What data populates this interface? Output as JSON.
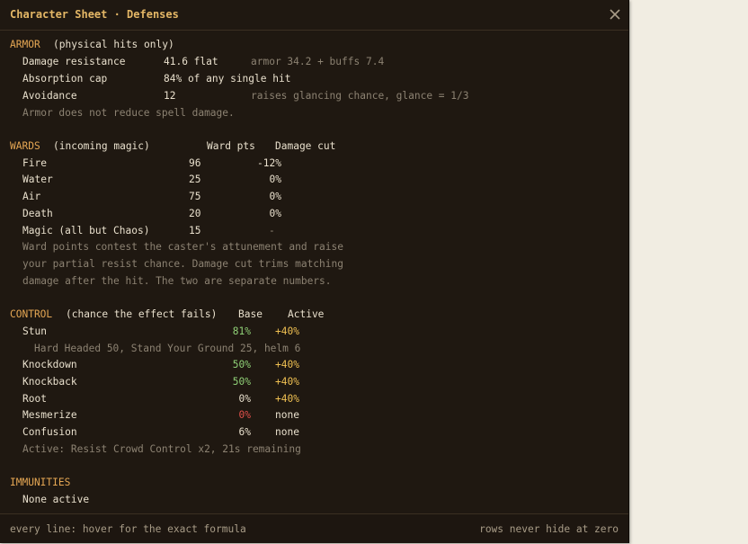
{
  "window": {
    "title": "Character Sheet · Defenses",
    "close_icon": "close-icon"
  },
  "armor": {
    "heading": "ARMOR",
    "subheading": "(physical hits only)",
    "rows": [
      {
        "label": "Damage resistance",
        "value": "41.6 flat",
        "note": "armor 34.2 + buffs 7.4"
      },
      {
        "label": "Absorption cap",
        "value": "84% of any single hit",
        "note": ""
      },
      {
        "label": "Avoidance",
        "value": "12",
        "note": "raises glancing chance, glance = 1/3"
      }
    ],
    "footnote": "Armor does not reduce spell damage."
  },
  "wards": {
    "heading": "WARDS",
    "subheading": "(incoming magic)",
    "col_pts": "Ward pts",
    "col_cut": "Damage cut",
    "rows": [
      {
        "label": "Fire",
        "pts": "96",
        "cut": "-12%"
      },
      {
        "label": "Water",
        "pts": "25",
        "cut": "0%"
      },
      {
        "label": "Air",
        "pts": "75",
        "cut": "0%"
      },
      {
        "label": "Death",
        "pts": "20",
        "cut": "0%"
      },
      {
        "label": "Magic (all but Chaos)",
        "pts": "15",
        "cut": "-"
      }
    ],
    "footnote": [
      "Ward points contest the caster's attunement and raise",
      "your partial resist chance. Damage cut trims matching",
      "damage after the hit. The two are separate numbers."
    ]
  },
  "control": {
    "heading": "CONTROL",
    "subheading": "(chance the effect fails)",
    "col_base": "Base",
    "col_active": "Active",
    "rows": [
      {
        "label": "Stun",
        "base": "81%",
        "active": "+40%",
        "base_color": "#8fcf76",
        "active_color": "#f0c152"
      },
      {
        "label": "Knockdown",
        "base": "50%",
        "active": "+40%",
        "base_color": "#8fcf76",
        "active_color": "#f0c152"
      },
      {
        "label": "Knockback",
        "base": "50%",
        "active": "+40%",
        "base_color": "#8fcf76",
        "active_color": "#f0c152"
      },
      {
        "label": "Root",
        "base": "0%",
        "active": "+40%",
        "base_color": "#e9e0cd",
        "active_color": "#f0c152"
      },
      {
        "label": "Mesmerize",
        "base": "0%",
        "active": "none",
        "base_color": "#e0504a",
        "active_color": "#e9e0cd"
      },
      {
        "label": "Confusion",
        "base": "6%",
        "active": "none",
        "base_color": "#e9e0cd",
        "active_color": "#e9e0cd"
      }
    ],
    "stun_detail": "Hard Headed 50, Stand Your Ground 25, helm 6",
    "footnote": "Active: Resist Crowd Control x2, 21s remaining"
  },
  "immunities": {
    "heading": "IMMUNITIES",
    "value": "None active"
  },
  "footer": {
    "left": "every line: hover for the exact formula",
    "right": "rows never hide at zero"
  }
}
